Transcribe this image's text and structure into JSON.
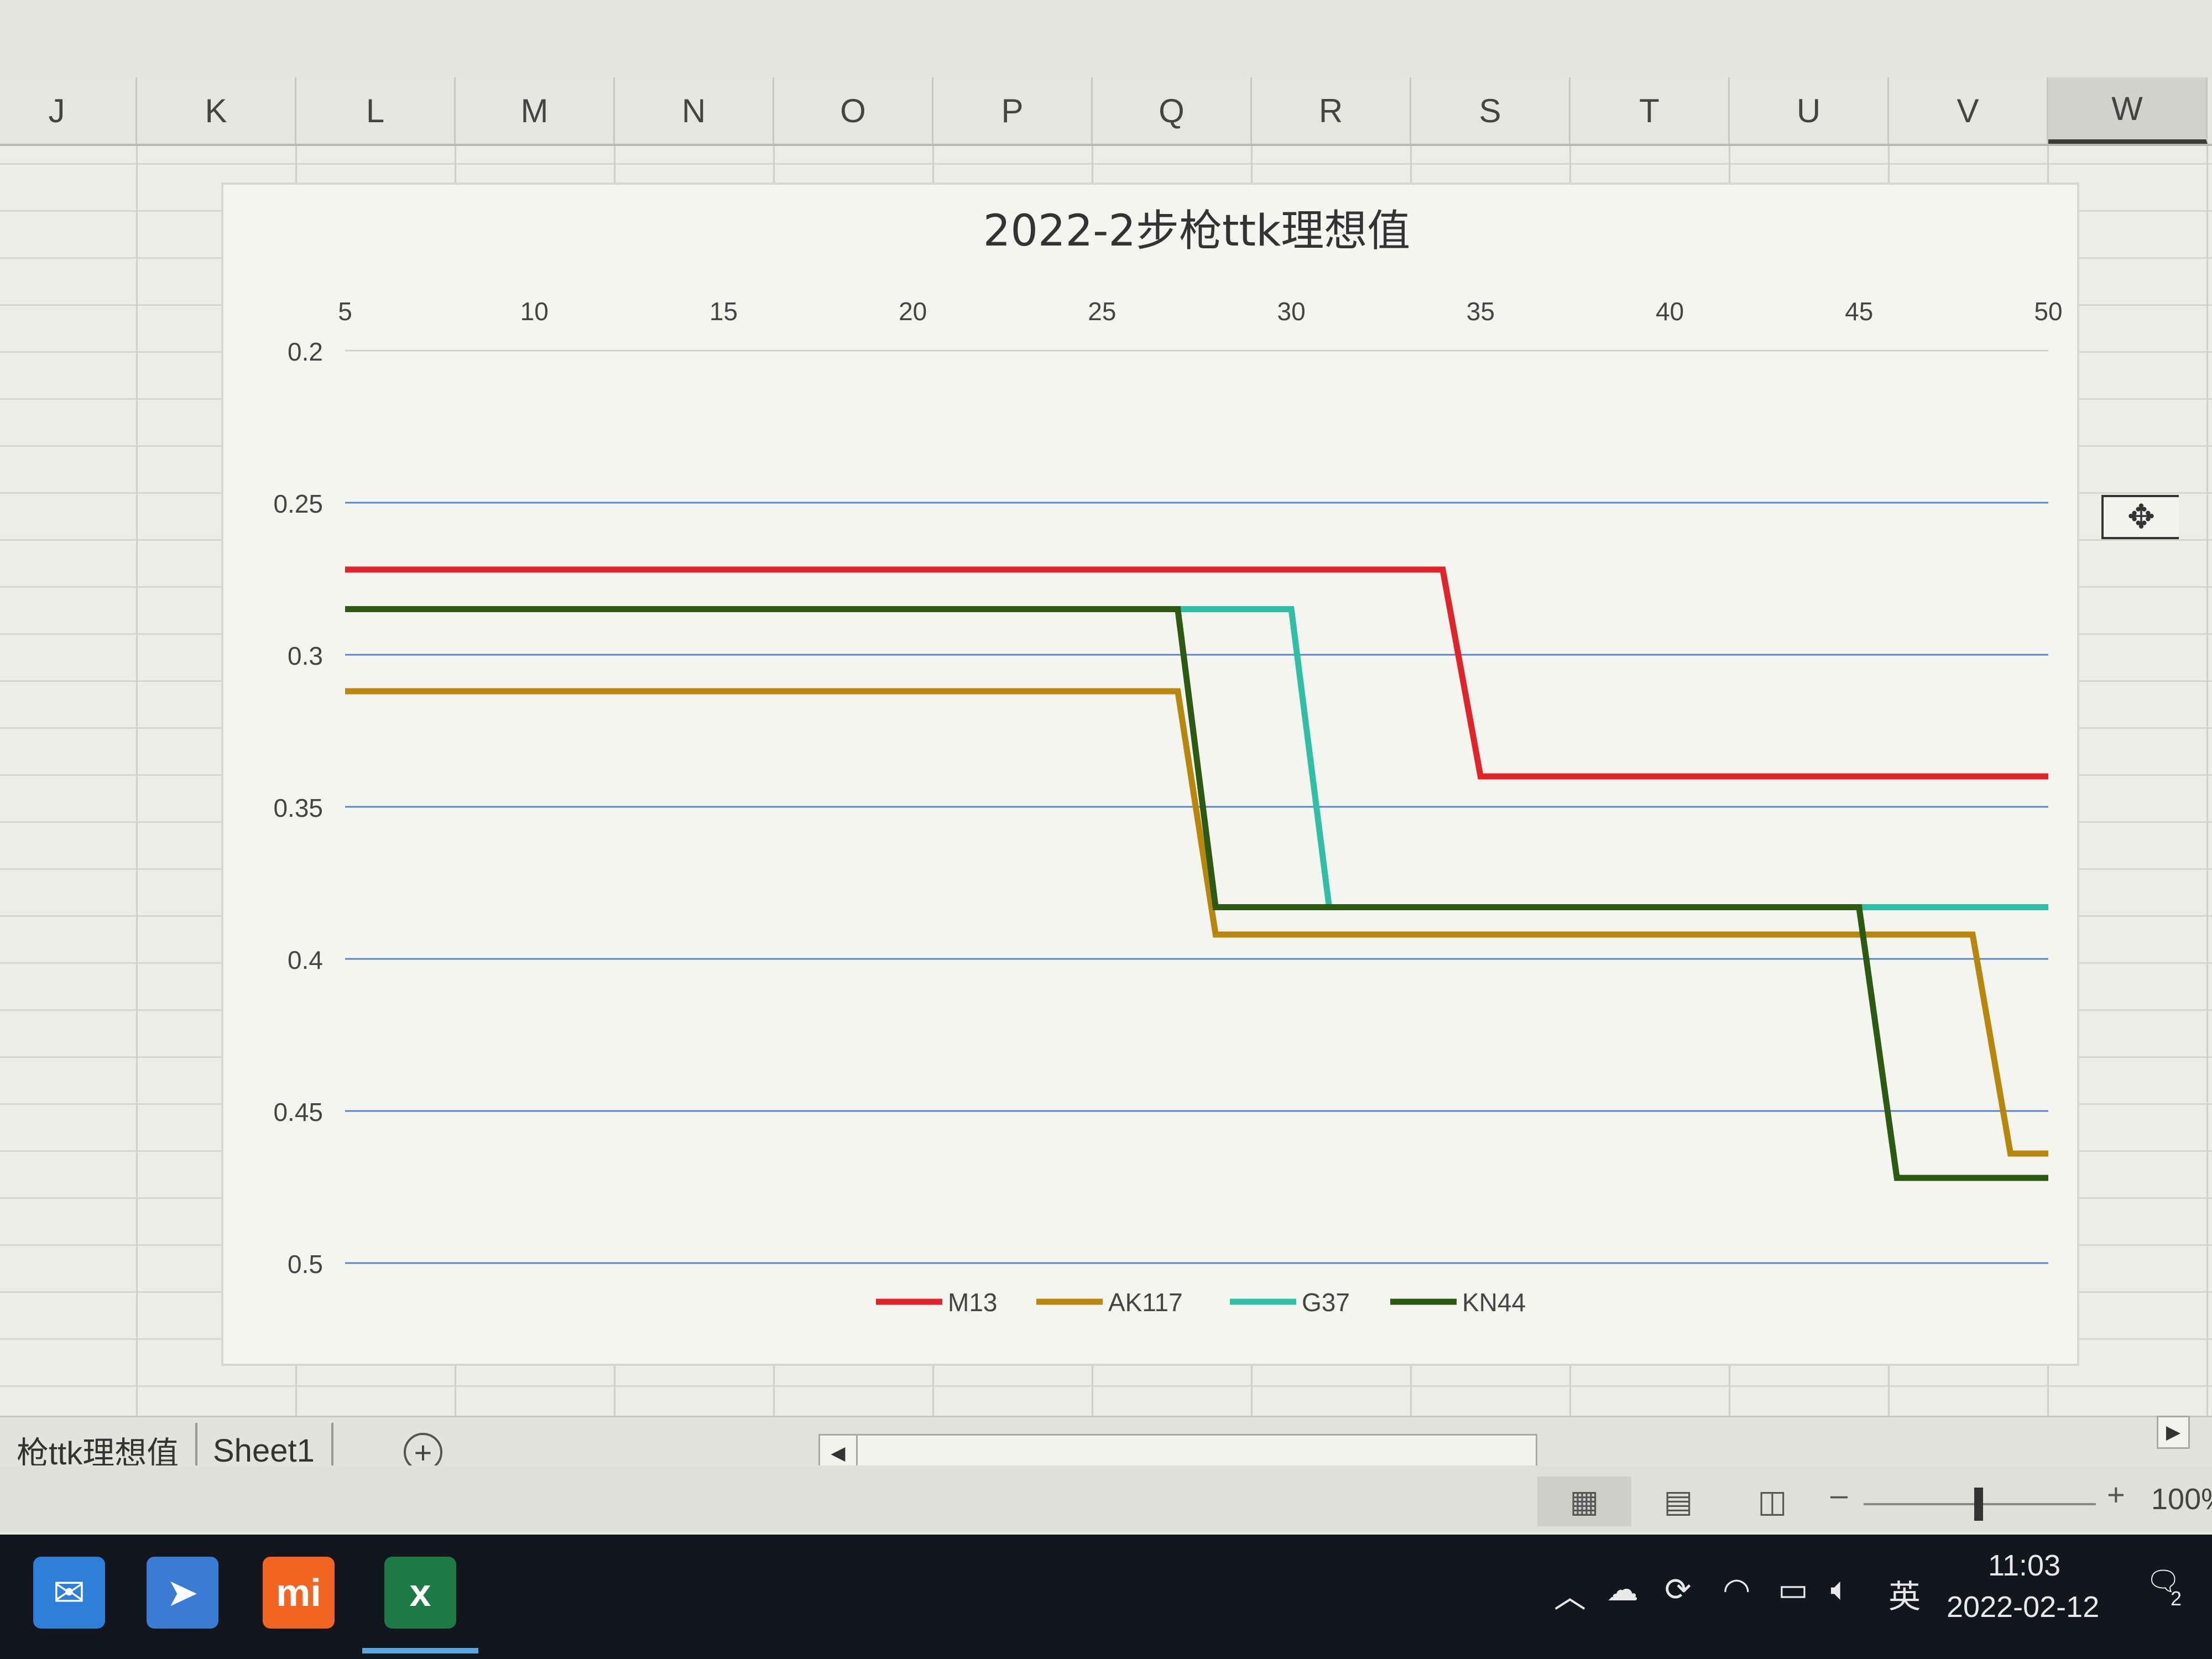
{
  "spreadsheet": {
    "columns": [
      "J",
      "K",
      "L",
      "M",
      "N",
      "O",
      "P",
      "Q",
      "R",
      "S",
      "T",
      "U",
      "V",
      "W"
    ],
    "selected_column": "W"
  },
  "chart_data": {
    "type": "line",
    "title": "2022-2步枪ttk理想值",
    "x": [
      5,
      6,
      7,
      8,
      9,
      10,
      11,
      12,
      13,
      14,
      15,
      16,
      17,
      18,
      19,
      20,
      21,
      22,
      23,
      24,
      25,
      26,
      27,
      28,
      29,
      30,
      31,
      32,
      33,
      34,
      35,
      36,
      37,
      38,
      39,
      40,
      41,
      42,
      43,
      44,
      45,
      46,
      47,
      48,
      49,
      50
    ],
    "xticks": [
      5,
      10,
      15,
      20,
      25,
      30,
      35,
      40,
      45,
      50
    ],
    "yticks": [
      0.2,
      0.25,
      0.3,
      0.35,
      0.4,
      0.45,
      0.5
    ],
    "ylim": [
      0.2,
      0.5
    ],
    "y_inverted": true,
    "x_axis_position": "top",
    "grid": true,
    "legend_position": "bottom",
    "series": [
      {
        "name": "M13",
        "color": "#e0242a",
        "steps": [
          [
            5,
            0.272
          ],
          [
            34,
            0.272
          ],
          [
            35,
            0.34
          ],
          [
            50,
            0.34
          ]
        ]
      },
      {
        "name": "AK117",
        "color": "#b8860b",
        "steps": [
          [
            5,
            0.312
          ],
          [
            27,
            0.312
          ],
          [
            28,
            0.392
          ],
          [
            48,
            0.392
          ],
          [
            49,
            0.464
          ],
          [
            50,
            0.464
          ]
        ]
      },
      {
        "name": "G37",
        "color": "#2ebfa5",
        "steps": [
          [
            5,
            0.285
          ],
          [
            30,
            0.285
          ],
          [
            31,
            0.383
          ],
          [
            50,
            0.383
          ]
        ]
      },
      {
        "name": "KN44",
        "color": "#2d5a12",
        "steps": [
          [
            5,
            0.285
          ],
          [
            27,
            0.285
          ],
          [
            28,
            0.383
          ],
          [
            45,
            0.383
          ],
          [
            46,
            0.472
          ],
          [
            50,
            0.472
          ]
        ]
      }
    ]
  },
  "sheet_tabs": [
    "枪ttk理想值",
    "Sheet1"
  ],
  "add_sheet_symbol": "+",
  "status": {
    "zoom_minus": "–",
    "zoom_plus": "+",
    "zoom_level": "100%"
  },
  "taskbar": {
    "time": "11:03",
    "date": "2022-02-12",
    "ime": "英",
    "notification_count": "2",
    "apps": [
      {
        "icon": "mail-icon",
        "color": "#2f7ed8"
      },
      {
        "icon": "feishu-icon",
        "color": "#3a7bd5"
      },
      {
        "icon": "mi-icon",
        "color": "#f26522",
        "label": "mi"
      },
      {
        "icon": "excel-icon",
        "color": "#1d7a45",
        "label": "x"
      }
    ]
  }
}
